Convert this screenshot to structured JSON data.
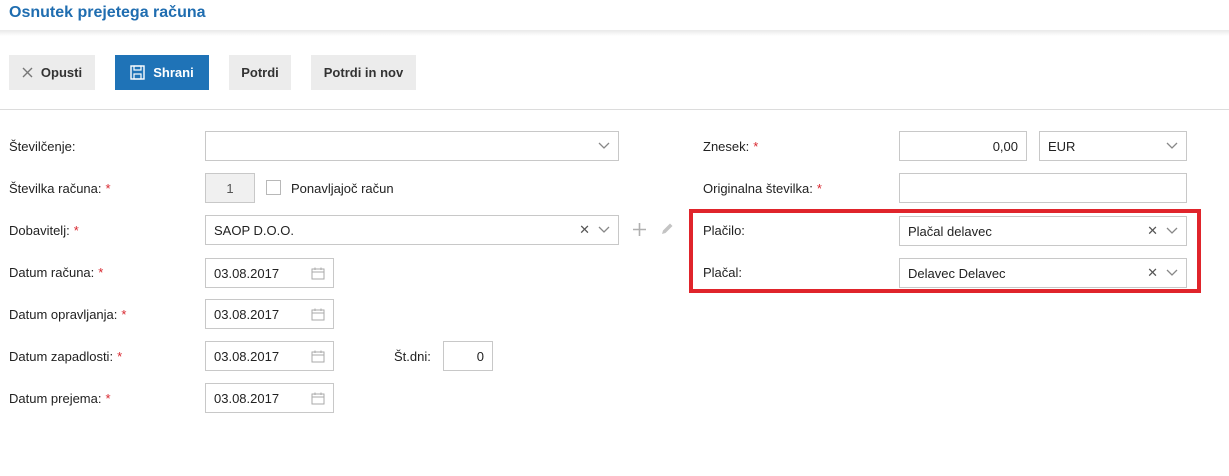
{
  "page": {
    "title": "Osnutek prejetega računa"
  },
  "toolbar": {
    "cancel_label": "Opusti",
    "save_label": "Shrani",
    "confirm_label": "Potrdi",
    "confirm_new_label": "Potrdi in nov",
    "primary_color": "#1f73b7"
  },
  "form_left": {
    "numbering": {
      "label": "Številčenje:",
      "value": ""
    },
    "invoice_number": {
      "label": "Številka računa:",
      "required": "*",
      "value": "1",
      "recurring_label": "Ponavljajoč račun",
      "recurring_checked": false
    },
    "supplier": {
      "label": "Dobavitelj:",
      "required": "*",
      "value": "SAOP D.O.O."
    },
    "invoice_date": {
      "label": "Datum računa:",
      "required": "*",
      "value": "03.08.2017"
    },
    "service_date": {
      "label": "Datum opravljanja:",
      "required": "*",
      "value": "03.08.2017"
    },
    "due_date": {
      "label": "Datum zapadlosti:",
      "required": "*",
      "value": "03.08.2017",
      "days_label": "Št.dni:",
      "days_value": "0"
    },
    "received_date": {
      "label": "Datum prejema:",
      "required": "*",
      "value": "03.08.2017"
    }
  },
  "form_right": {
    "amount": {
      "label": "Znesek:",
      "required": "*",
      "value": "0,00",
      "currency": "EUR"
    },
    "original_number": {
      "label": "Originalna številka:",
      "required": "*",
      "value": ""
    },
    "payment": {
      "label": "Plačilo:",
      "value": "Plačal delavec"
    },
    "paid_by": {
      "label": "Plačal:",
      "value": "Delavec Delavec"
    },
    "highlight_color": "#e0242b"
  },
  "icons": {
    "cancel": "close-icon",
    "save": "save-icon",
    "dropdown": "chevron-down-icon",
    "clear": "clear-icon",
    "add": "plus-icon",
    "edit": "pencil-icon",
    "date": "calendar-icon"
  }
}
